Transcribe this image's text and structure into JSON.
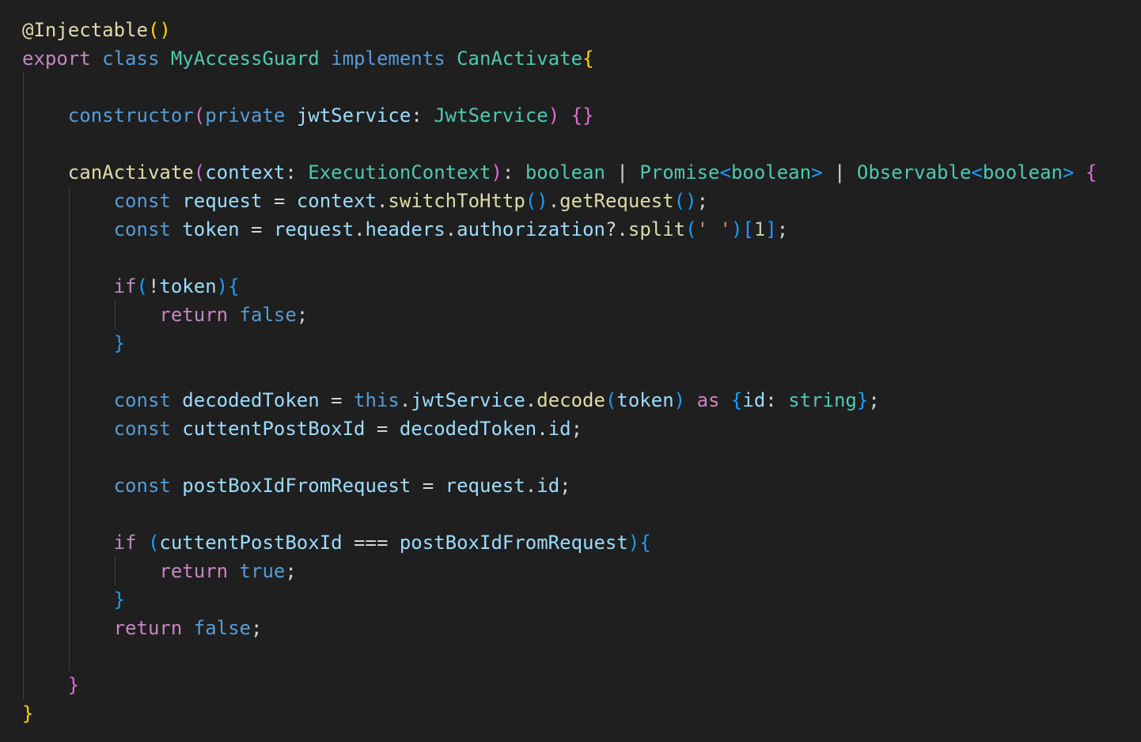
{
  "editor": {
    "theme": "dark",
    "background": "#1f1f1f",
    "lines": [
      [
        [
          "dec",
          "@Injectable"
        ],
        [
          "br1",
          "()"
        ]
      ],
      [
        [
          "ctrl",
          "export"
        ],
        [
          "plain",
          " "
        ],
        [
          "kw",
          "class"
        ],
        [
          "plain",
          " "
        ],
        [
          "type",
          "MyAccessGuard"
        ],
        [
          "plain",
          " "
        ],
        [
          "kw",
          "implements"
        ],
        [
          "plain",
          " "
        ],
        [
          "type",
          "CanActivate"
        ],
        [
          "br1",
          "{"
        ]
      ],
      [],
      [
        [
          "plain",
          "    "
        ],
        [
          "kw",
          "constructor"
        ],
        [
          "br2",
          "("
        ],
        [
          "kw",
          "private"
        ],
        [
          "plain",
          " "
        ],
        [
          "var",
          "jwtService"
        ],
        [
          "plain",
          ": "
        ],
        [
          "type",
          "JwtService"
        ],
        [
          "br2",
          ")"
        ],
        [
          "plain",
          " "
        ],
        [
          "br2",
          "{}"
        ]
      ],
      [],
      [
        [
          "plain",
          "    "
        ],
        [
          "fn",
          "canActivate"
        ],
        [
          "br2",
          "("
        ],
        [
          "var",
          "context"
        ],
        [
          "plain",
          ": "
        ],
        [
          "type",
          "ExecutionContext"
        ],
        [
          "br2",
          ")"
        ],
        [
          "plain",
          ": "
        ],
        [
          "type",
          "boolean"
        ],
        [
          "plain",
          " | "
        ],
        [
          "type",
          "Promise"
        ],
        [
          "br3",
          "<"
        ],
        [
          "type",
          "boolean"
        ],
        [
          "br3",
          ">"
        ],
        [
          "plain",
          " | "
        ],
        [
          "type",
          "Observable"
        ],
        [
          "br3",
          "<"
        ],
        [
          "type",
          "boolean"
        ],
        [
          "br3",
          ">"
        ],
        [
          "plain",
          " "
        ],
        [
          "br2",
          "{"
        ]
      ],
      [
        [
          "plain",
          "        "
        ],
        [
          "kw",
          "const"
        ],
        [
          "plain",
          " "
        ],
        [
          "var",
          "request"
        ],
        [
          "plain",
          " = "
        ],
        [
          "var",
          "context"
        ],
        [
          "plain",
          "."
        ],
        [
          "fn",
          "switchToHttp"
        ],
        [
          "br3",
          "()"
        ],
        [
          "plain",
          "."
        ],
        [
          "fn",
          "getRequest"
        ],
        [
          "br3",
          "()"
        ],
        [
          "plain",
          ";"
        ]
      ],
      [
        [
          "plain",
          "        "
        ],
        [
          "kw",
          "const"
        ],
        [
          "plain",
          " "
        ],
        [
          "var",
          "token"
        ],
        [
          "plain",
          " = "
        ],
        [
          "var",
          "request"
        ],
        [
          "plain",
          "."
        ],
        [
          "prop",
          "headers"
        ],
        [
          "plain",
          "."
        ],
        [
          "prop",
          "authorization"
        ],
        [
          "plain",
          "?."
        ],
        [
          "fn",
          "split"
        ],
        [
          "br3",
          "("
        ],
        [
          "str",
          "' '"
        ],
        [
          "br3",
          ")"
        ],
        [
          "br3",
          "["
        ],
        [
          "num",
          "1"
        ],
        [
          "br3",
          "]"
        ],
        [
          "plain",
          ";"
        ]
      ],
      [],
      [
        [
          "plain",
          "        "
        ],
        [
          "ctrl",
          "if"
        ],
        [
          "br3",
          "("
        ],
        [
          "plain",
          "!"
        ],
        [
          "var",
          "token"
        ],
        [
          "br3",
          ")"
        ],
        [
          "br3",
          "{"
        ]
      ],
      [
        [
          "plain",
          "            "
        ],
        [
          "ctrl",
          "return"
        ],
        [
          "plain",
          " "
        ],
        [
          "kw",
          "false"
        ],
        [
          "plain",
          ";"
        ]
      ],
      [
        [
          "plain",
          "        "
        ],
        [
          "br3",
          "}"
        ]
      ],
      [],
      [
        [
          "plain",
          "        "
        ],
        [
          "kw",
          "const"
        ],
        [
          "plain",
          " "
        ],
        [
          "var",
          "decodedToken"
        ],
        [
          "plain",
          " = "
        ],
        [
          "kw",
          "this"
        ],
        [
          "plain",
          "."
        ],
        [
          "prop",
          "jwtService"
        ],
        [
          "plain",
          "."
        ],
        [
          "fn",
          "decode"
        ],
        [
          "br3",
          "("
        ],
        [
          "var",
          "token"
        ],
        [
          "br3",
          ")"
        ],
        [
          "plain",
          " "
        ],
        [
          "ctrl",
          "as"
        ],
        [
          "plain",
          " "
        ],
        [
          "br3",
          "{"
        ],
        [
          "prop",
          "id"
        ],
        [
          "plain",
          ": "
        ],
        [
          "type",
          "string"
        ],
        [
          "br3",
          "}"
        ],
        [
          "plain",
          ";"
        ]
      ],
      [
        [
          "plain",
          "        "
        ],
        [
          "kw",
          "const"
        ],
        [
          "plain",
          " "
        ],
        [
          "var",
          "cuttentPostBoxId"
        ],
        [
          "plain",
          " = "
        ],
        [
          "var",
          "decodedToken"
        ],
        [
          "plain",
          "."
        ],
        [
          "prop",
          "id"
        ],
        [
          "plain",
          ";"
        ]
      ],
      [],
      [
        [
          "plain",
          "        "
        ],
        [
          "kw",
          "const"
        ],
        [
          "plain",
          " "
        ],
        [
          "var",
          "postBoxIdFromRequest"
        ],
        [
          "plain",
          " = "
        ],
        [
          "var",
          "request"
        ],
        [
          "plain",
          "."
        ],
        [
          "prop",
          "id"
        ],
        [
          "plain",
          ";"
        ]
      ],
      [],
      [
        [
          "plain",
          "        "
        ],
        [
          "ctrl",
          "if"
        ],
        [
          "plain",
          " "
        ],
        [
          "br3",
          "("
        ],
        [
          "var",
          "cuttentPostBoxId"
        ],
        [
          "plain",
          " === "
        ],
        [
          "var",
          "postBoxIdFromRequest"
        ],
        [
          "br3",
          ")"
        ],
        [
          "br3",
          "{"
        ]
      ],
      [
        [
          "plain",
          "            "
        ],
        [
          "ctrl",
          "return"
        ],
        [
          "plain",
          " "
        ],
        [
          "kw",
          "true"
        ],
        [
          "plain",
          ";"
        ]
      ],
      [
        [
          "plain",
          "        "
        ],
        [
          "br3",
          "}"
        ]
      ],
      [
        [
          "plain",
          "        "
        ],
        [
          "ctrl",
          "return"
        ],
        [
          "plain",
          " "
        ],
        [
          "kw",
          "false"
        ],
        [
          "plain",
          ";"
        ]
      ],
      [],
      [
        [
          "plain",
          "    "
        ],
        [
          "br2",
          "}"
        ]
      ],
      [
        [
          "br1",
          "}"
        ]
      ]
    ]
  }
}
